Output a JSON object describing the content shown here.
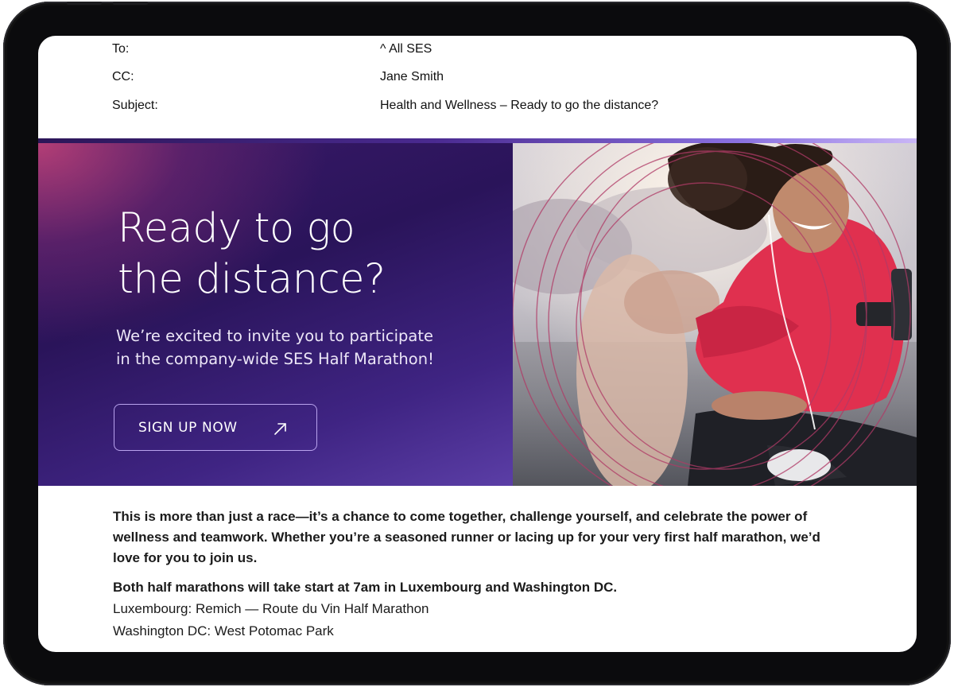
{
  "email_header": {
    "to_label": "To:",
    "to_value": "^ All SES",
    "cc_label": "CC:",
    "cc_value": "Jane Smith",
    "subject_label": "Subject:",
    "subject_value": "Health and Wellness – Ready to go the distance?"
  },
  "hero": {
    "title_line1": "Ready to go",
    "title_line2": "the distance?",
    "subtitle_line1": "We’re excited to invite you to participate",
    "subtitle_line2": "in the company-wide SES Half Marathon!",
    "cta_label": "SIGN UP NOW",
    "cta_icon": "arrow-up-right-icon",
    "photo": "runner-stretching-photo"
  },
  "body": {
    "paragraph1": "This is more than just a race—it’s a chance to come together, challenge yourself, and celebrate the power of wellness and teamwork. Whether you’re a seasoned runner or lacing up for your very first half marathon, we’d love for you to join us.",
    "paragraph2": "Both half marathons will take start at 7am in Luxembourg and Washington DC.",
    "location1": "Luxembourg: Remich — Route du Vin Half Marathon",
    "location2": "Washington DC: West Potomac Park"
  },
  "colors": {
    "accent_purple": "#3f2483",
    "accent_magenta": "#c84478",
    "cta_border": "#b9a3ee",
    "shirt_red": "#e0304f"
  }
}
